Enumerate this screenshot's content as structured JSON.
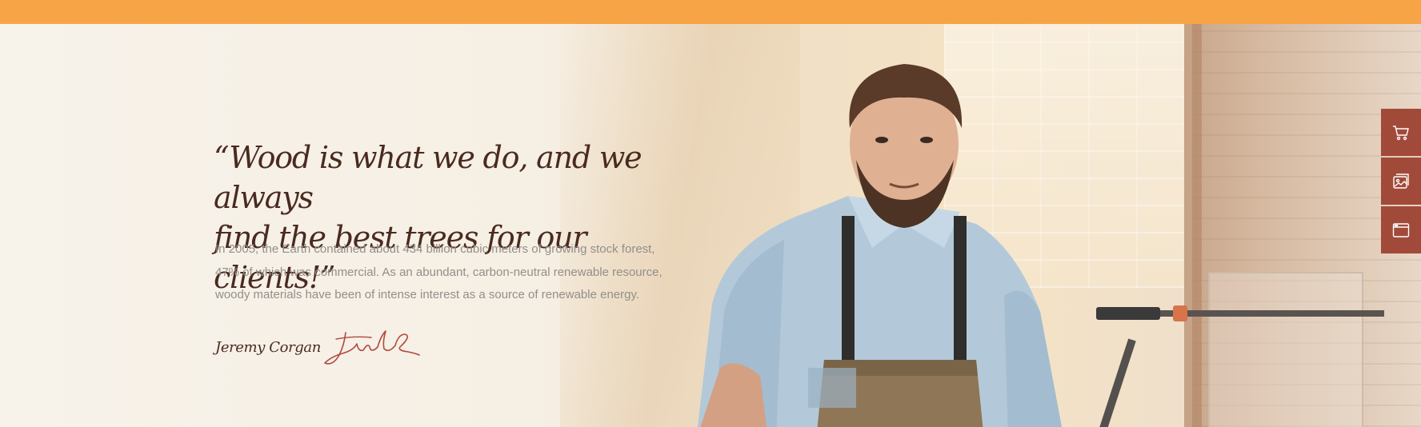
{
  "quote": {
    "line1": "“Wood is what we do, and we always",
    "line2": "find the best trees for our clients!”"
  },
  "paragraph": {
    "line1": "In 2005, the Earth contained about 434 billion cubic meters of growing stock forest,",
    "line2": "47% of which was commercial. As an abundant, carbon-neutral renewable resource,",
    "line3": "woody materials have been of intense interest as a source of renewable energy."
  },
  "author": {
    "name": "Jeremy Corgan"
  },
  "side_toolbar": {
    "items": [
      {
        "icon": "cart-icon"
      },
      {
        "icon": "gallery-icon"
      },
      {
        "icon": "browser-window-icon"
      }
    ]
  },
  "colors": {
    "top_bar": "#f7a446",
    "heading": "#4a2a1f",
    "body_text": "#938e8a",
    "toolbar": "#a24a3a"
  }
}
